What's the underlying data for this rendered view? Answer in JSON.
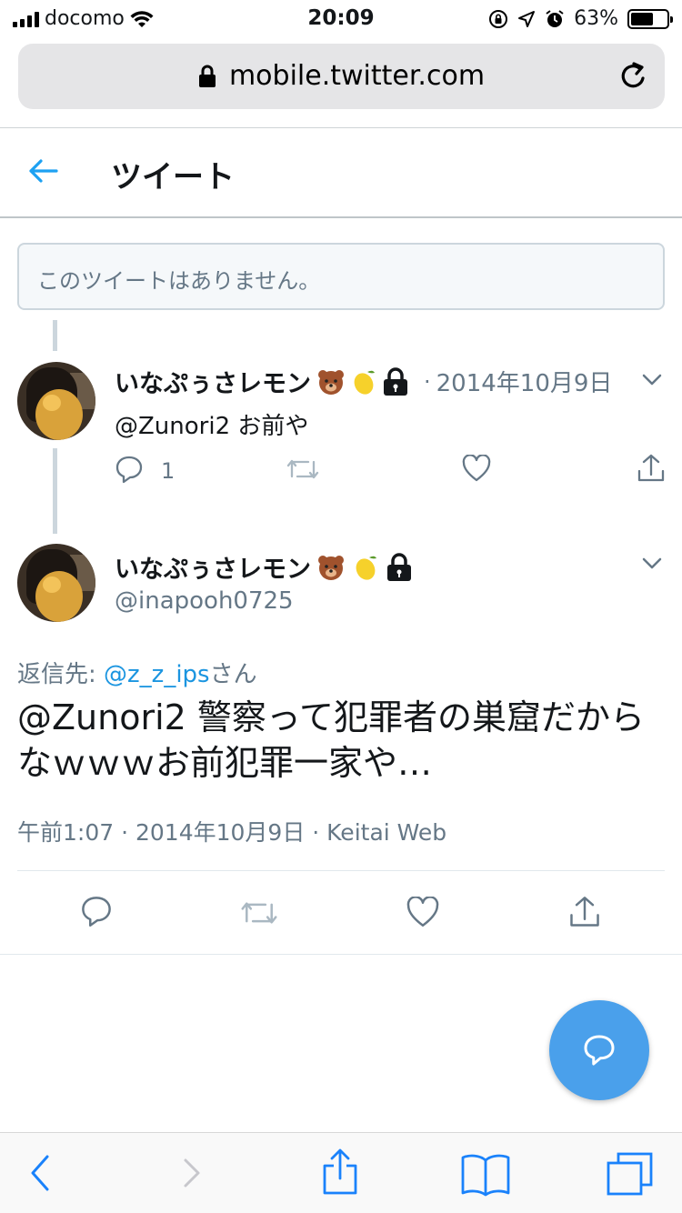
{
  "status_bar": {
    "carrier": "docomo",
    "time": "20:09",
    "battery": "63%",
    "battery_level": 0.63
  },
  "browser": {
    "url": "mobile.twitter.com"
  },
  "header": {
    "title": "ツイート"
  },
  "unavailable_tweet": {
    "text": "このツイートはありません。"
  },
  "reply_tweet": {
    "display_name": "いなぷぅさレモン",
    "date": "2014年10月9日",
    "text": "@Zunori2 お前や",
    "reply_count": "1"
  },
  "main_tweet": {
    "display_name": "いなぷぅさレモン",
    "handle": "@inapooh0725",
    "reply_to_prefix": "返信先: ",
    "reply_to_user": "@z_z_ips",
    "reply_to_suffix": "さん",
    "text": "@Zunori2 警察って犯罪者の巣窟だからなｗｗｗお前犯罪一家や…",
    "timestamp": "午前1:07 · 2014年10月9日 · Keitai Web"
  },
  "colors": {
    "accent": "#1da1f2",
    "fab": "#4aa0eb",
    "ios_blue": "#1a82fb",
    "muted": "#657786"
  }
}
